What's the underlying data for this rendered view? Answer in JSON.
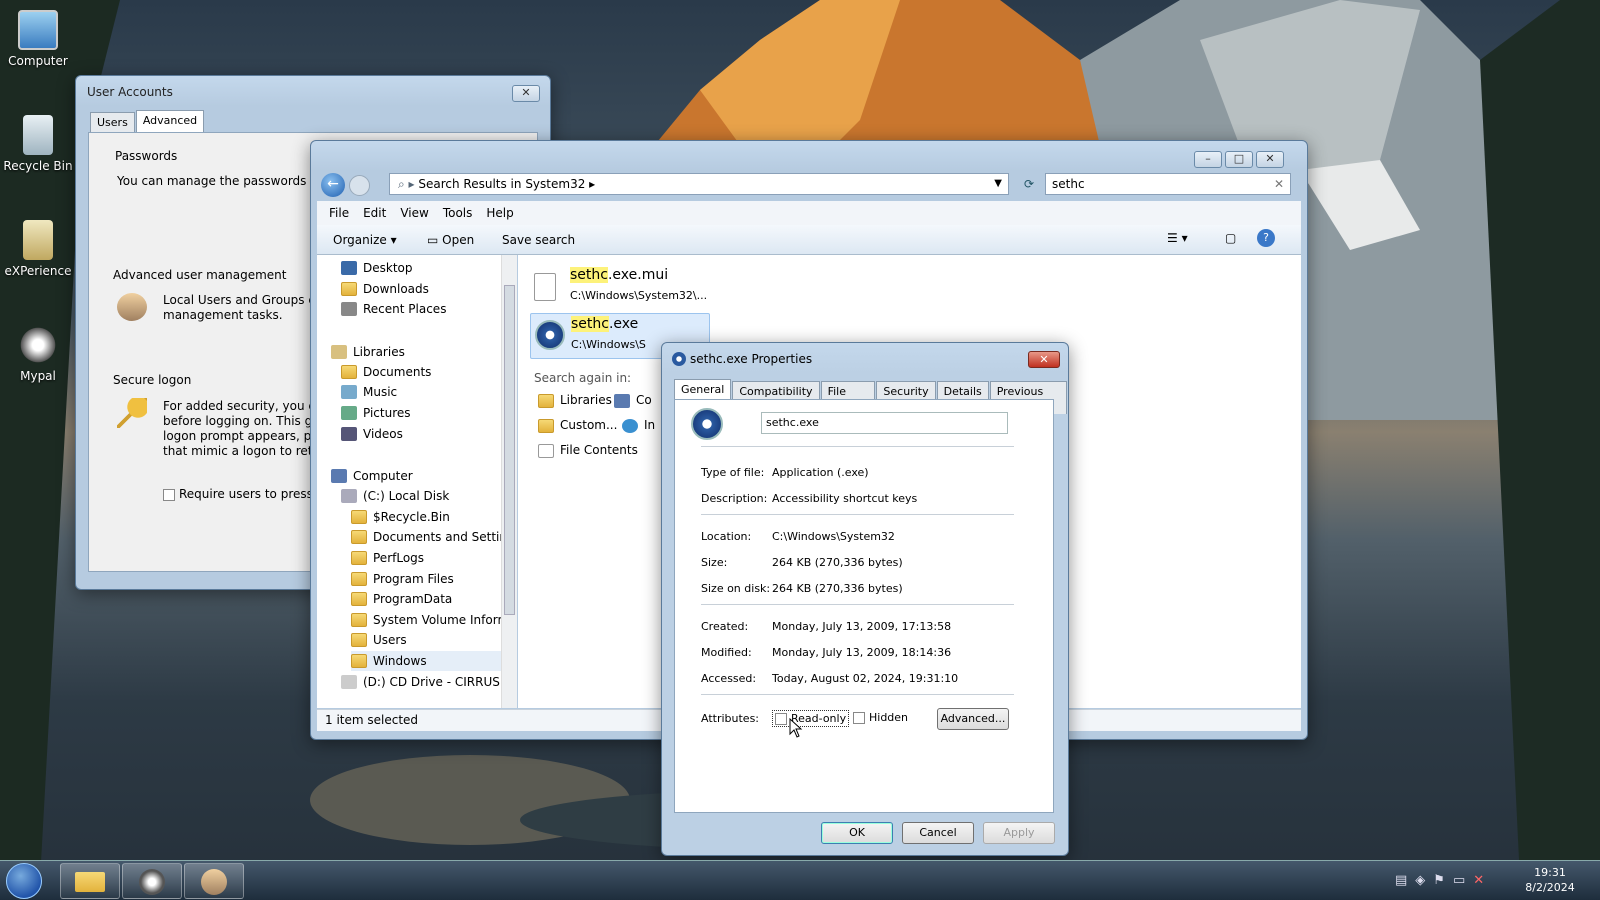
{
  "desktop": {
    "icons": [
      {
        "label": "Computer"
      },
      {
        "label": "Recycle Bin"
      },
      {
        "label": "eXPerience"
      },
      {
        "label": "Mypal"
      }
    ]
  },
  "user_accounts": {
    "title": "User Accounts",
    "tabs": [
      "Users",
      "Advanced"
    ],
    "passwords_title": "Passwords",
    "passwords_text": "You can manage the passwords you",
    "aum_title": "Advanced user management",
    "aum_text1": "Local Users and Groups can",
    "aum_text2": "management tasks.",
    "secure_title": "Secure logon",
    "secure_text1": "For added security, you can",
    "secure_text2": "before logging on. This gua",
    "secure_text3": "logon prompt appears, prot",
    "secure_text4": "that mimic a logon to retrie",
    "require_label": "Require users to press Ct"
  },
  "explorer": {
    "breadcrumb": "Search Results in System32",
    "search_value": "sethc",
    "menu": [
      "File",
      "Edit",
      "View",
      "Tools",
      "Help"
    ],
    "toolbar": {
      "organize": "Organize",
      "open": "Open",
      "save_search": "Save search"
    },
    "tree": [
      {
        "label": "Desktop",
        "indent": 0
      },
      {
        "label": "Downloads",
        "indent": 0
      },
      {
        "label": "Recent Places",
        "indent": 0
      },
      {
        "label": "Libraries",
        "indent": -1
      },
      {
        "label": "Documents",
        "indent": 0
      },
      {
        "label": "Music",
        "indent": 0
      },
      {
        "label": "Pictures",
        "indent": 0
      },
      {
        "label": "Videos",
        "indent": 0
      },
      {
        "label": "Computer",
        "indent": -1
      },
      {
        "label": "(C:) Local Disk",
        "indent": 0
      },
      {
        "label": "$Recycle.Bin",
        "indent": 1
      },
      {
        "label": "Documents and Settings",
        "indent": 1
      },
      {
        "label": "PerfLogs",
        "indent": 1
      },
      {
        "label": "Program Files",
        "indent": 1
      },
      {
        "label": "ProgramData",
        "indent": 1
      },
      {
        "label": "System Volume Informa",
        "indent": 1
      },
      {
        "label": "Users",
        "indent": 1
      },
      {
        "label": "Windows",
        "indent": 1
      },
      {
        "label": "(D:) CD Drive - CIRRUS",
        "indent": 0
      }
    ],
    "results": [
      {
        "name_hl": "sethc",
        "name_rest": ".exe.mui",
        "path": "C:\\Windows\\System32\\..."
      },
      {
        "name_hl": "sethc",
        "name_rest": ".exe",
        "path": "C:\\Windows\\S"
      }
    ],
    "search_again": "Search again in:",
    "search_links": [
      "Libraries",
      "Co",
      "Custom...",
      "In",
      "File Contents"
    ],
    "status": "1 item selected"
  },
  "properties": {
    "title": "sethc.exe Properties",
    "tabs": [
      "General",
      "Compatibility",
      "File Hashes",
      "Security",
      "Details",
      "Previous Versions"
    ],
    "filename": "sethc.exe",
    "type_label": "Type of file:",
    "type_value": "Application (.exe)",
    "desc_label": "Description:",
    "desc_value": "Accessibility shortcut keys",
    "location_label": "Location:",
    "location_value": "C:\\Windows\\System32",
    "size_label": "Size:",
    "size_value": "264 KB (270,336 bytes)",
    "sizedisk_label": "Size on disk:",
    "sizedisk_value": "264 KB (270,336 bytes)",
    "created_label": "Created:",
    "created_value": "Monday, July 13, 2009, 17:13:58",
    "modified_label": "Modified:",
    "modified_value": "Monday, July 13, 2009, 18:14:36",
    "accessed_label": "Accessed:",
    "accessed_value": "Today, August 02, 2024, 19:31:10",
    "attributes_label": "Attributes:",
    "readonly_label": "Read-only",
    "hidden_label": "Hidden",
    "advanced_label": "Advanced...",
    "ok": "OK",
    "cancel": "Cancel",
    "apply": "Apply"
  },
  "taskbar": {
    "time": "19:31",
    "date": "8/2/2024"
  }
}
